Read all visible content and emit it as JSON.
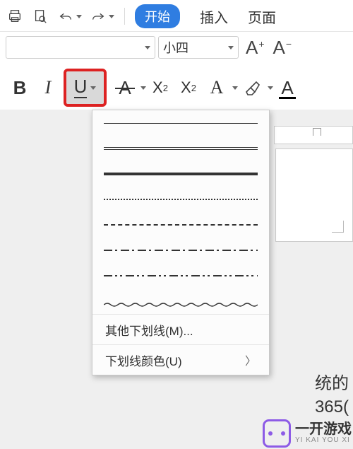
{
  "tabs": {
    "start": "开始",
    "insert": "插入",
    "page": "页面"
  },
  "font": {
    "size": "小四"
  },
  "sizebtn": {
    "inc": "+",
    "dec": "−"
  },
  "style": {
    "bold": "B",
    "italic": "I",
    "underline": "U",
    "strike": "A",
    "sup": "X",
    "sub": "X",
    "stylesA": "A",
    "colorA": "A"
  },
  "dropdown": {
    "more": "其他下划线(M)...",
    "color": "下划线颜色(U)"
  },
  "docfrag": {
    "line1": "统的",
    "line2": "365("
  },
  "watermark": {
    "title": "一开游戏",
    "sub": "YI KAI YOU XI"
  }
}
